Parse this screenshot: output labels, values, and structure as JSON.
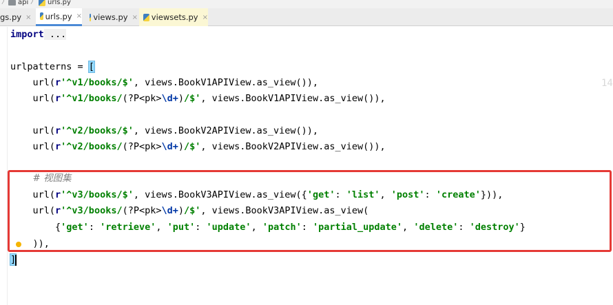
{
  "breadcrumb": {
    "items": [
      {
        "label": "api",
        "icon": "folder-icon"
      },
      {
        "label": "urls.py",
        "icon": "python-file-icon"
      }
    ]
  },
  "tabs": [
    {
      "label": "gs.py",
      "close": "×",
      "active": false,
      "highlighted": false
    },
    {
      "label": "urls.py",
      "close": "×",
      "active": true,
      "highlighted": false
    },
    {
      "label": "views.py",
      "close": "×",
      "active": false,
      "highlighted": false
    },
    {
      "label": "viewsets.py",
      "close": "×",
      "active": false,
      "highlighted": true
    }
  ],
  "editor": {
    "code": {
      "import_kw": "import",
      "import_fold": " ...",
      "urlpatterns_head": "urlpatterns = ",
      "open_bracket": "[",
      "indent": "    ",
      "url_open": "url(",
      "r": "r",
      "v1_list": "'^v1/books/$'",
      "v1_list_rest": ", views.BookV1APIView.as_view()),",
      "v1_detail_pre": "'^v1/books/",
      "group_open": "(?P<pk>",
      "esc_d": "\\d+",
      "group_close": ")",
      "detail_post": "/$'",
      "v1_detail_rest": ", views.BookV1APIView.as_view()),",
      "v2_list": "'^v2/books/$'",
      "v2_list_rest": ", views.BookV2APIView.as_view()),",
      "v2_detail_pre": "'^v2/books/",
      "v2_detail_rest": ", views.BookV2APIView.as_view()),",
      "comment": "# 视图集",
      "v3_list": "'^v3/books/$'",
      "v3_list_mid": ", views.BookV3APIView.as_view({",
      "k_get": "'get'",
      "v_list": "'list'",
      "k_post": "'post'",
      "v_create": "'create'",
      "v3_list_end": "})),",
      "v3_detail_pre": "'^v3/books/",
      "v3_detail_rest": ", views.BookV3APIView.as_view(",
      "indent2": "        ",
      "brace_open": "{",
      "v_retrieve": "'retrieve'",
      "k_put": "'put'",
      "v_update": "'update'",
      "k_patch": "'patch'",
      "v_partial_update": "'partial_update'",
      "k_delete": "'delete'",
      "v_destroy": "'destroy'",
      "brace_close": "}",
      "colon": ": ",
      "comma": ", ",
      "close_paren_line": "    )),",
      "close_bracket": "]"
    },
    "edge_mark": "14"
  },
  "colors": {
    "keyword": "#000080",
    "string": "#008000",
    "escape": "#0037a6",
    "comment": "#808080",
    "highlight_box": "#e53935",
    "active_tab_underline": "#4b8ad6"
  }
}
